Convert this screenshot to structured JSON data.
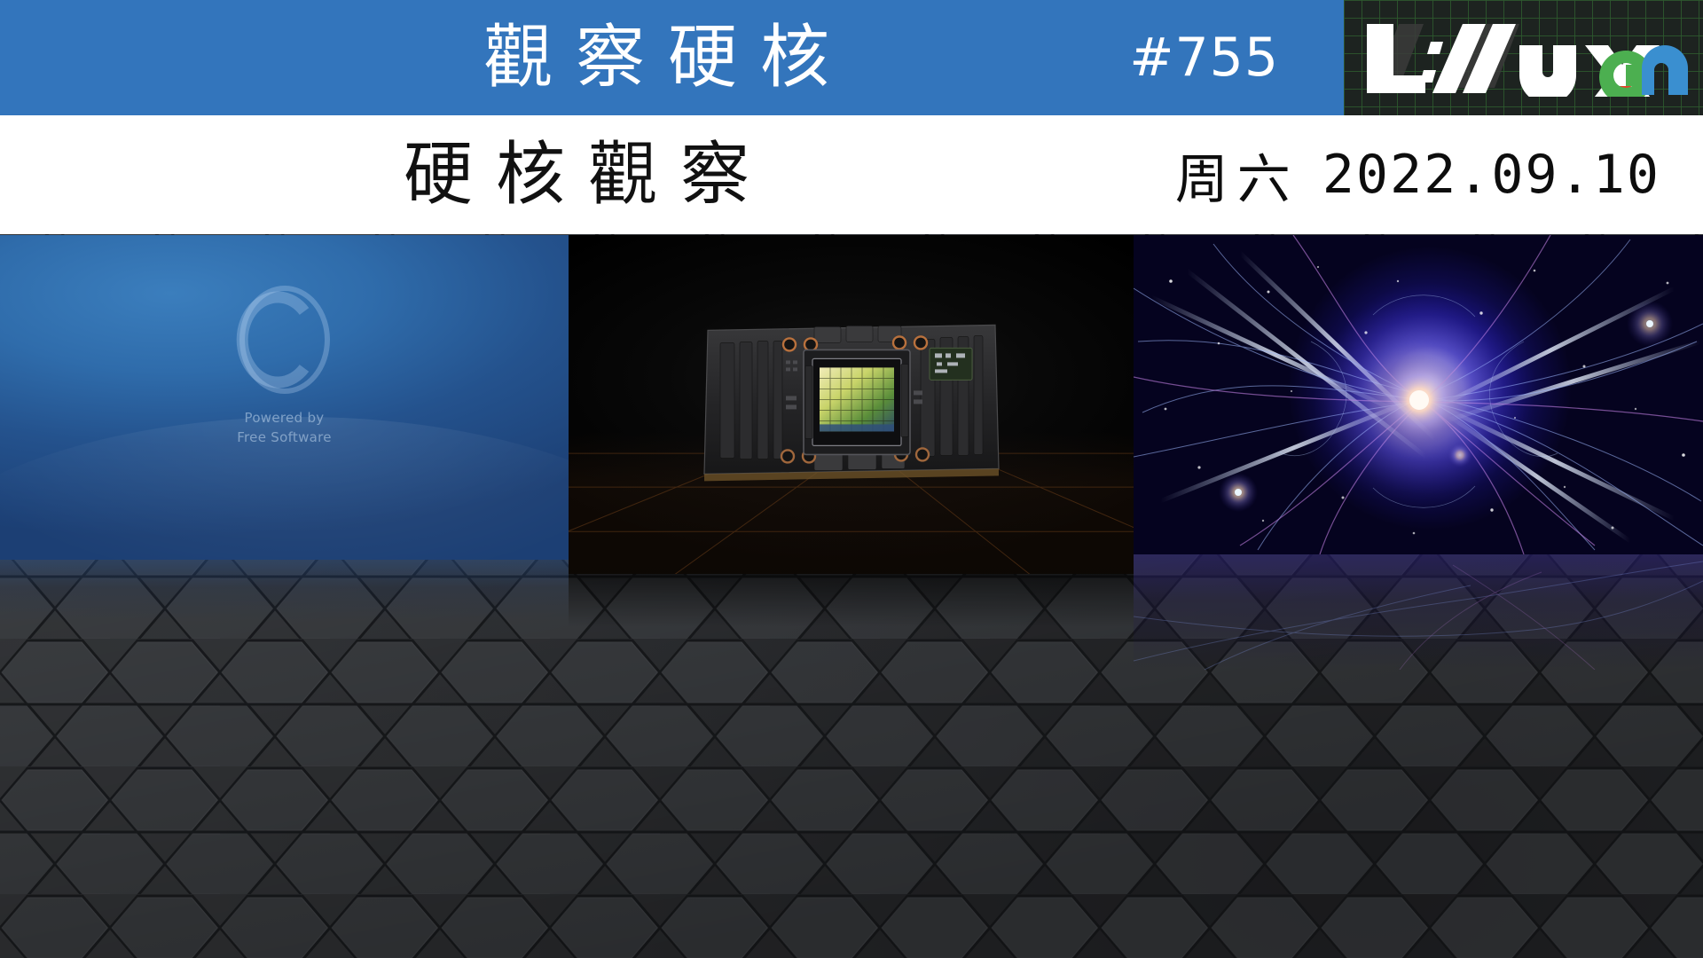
{
  "header": {
    "title_line1": "觀察硬核",
    "title_line2": "硬核觀察",
    "issue_number": "#755",
    "weekday": "周六",
    "date": "2022.09.10",
    "logo": {
      "text_main": "L://ux",
      "text_suffix": "cn",
      "dot_color": "#e8412a",
      "c_color": "#4caf50",
      "n_color": "#3a8fd0",
      "plate_bg": "#1d2320",
      "grid_color": "#2e5a2e"
    },
    "blue": "#3375bc",
    "white": "#ffffff"
  },
  "panels": [
    {
      "name": "opensuse-wallpaper",
      "caption_line1": "Powered by",
      "caption_line2": "Free Software",
      "accent": "#2f6cab"
    },
    {
      "name": "nvidia-h100-gpu-module",
      "accent": "#000000"
    },
    {
      "name": "quantum-particle-burst",
      "accent": "#2a1f9e"
    }
  ],
  "background": {
    "name": "hexagon-honeycomb",
    "color": "#3b3d40"
  }
}
